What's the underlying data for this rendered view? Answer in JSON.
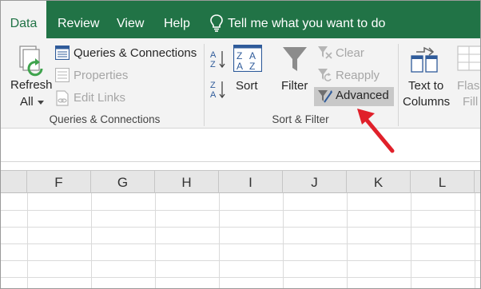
{
  "tabs": {
    "data": "Data",
    "review": "Review",
    "view": "View",
    "help": "Help",
    "tell_me": "Tell me what you want to do"
  },
  "ribbon": {
    "queries_group": {
      "refresh_line1": "Refresh",
      "refresh_line2": "All",
      "queries_connections": "Queries & Connections",
      "properties": "Properties",
      "edit_links": "Edit Links",
      "label": "Queries & Connections"
    },
    "sort_filter_group": {
      "sort": "Sort",
      "filter": "Filter",
      "clear": "Clear",
      "reapply": "Reapply",
      "advanced": "Advanced",
      "label": "Sort & Filter"
    },
    "data_tools_group": {
      "text_to_line1": "Text to",
      "text_to_line2": "Columns",
      "flash_line1": "Flash",
      "flash_line2": "Fill"
    }
  },
  "grid": {
    "columns": [
      "F",
      "G",
      "H",
      "I",
      "J",
      "K",
      "L"
    ]
  },
  "colors": {
    "tab_bar": "#217346",
    "annotation_arrow": "#e0202a"
  }
}
